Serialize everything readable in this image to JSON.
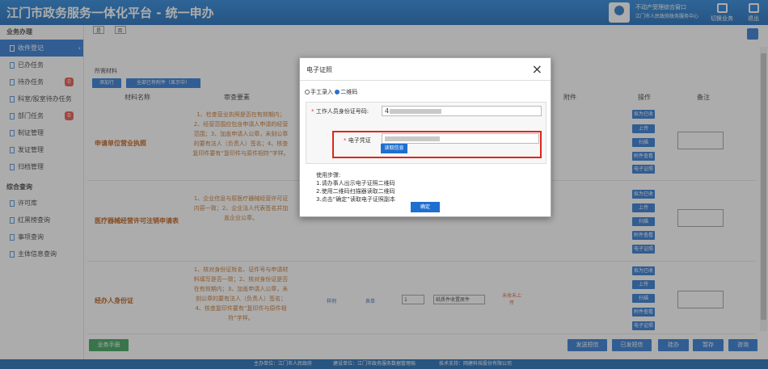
{
  "header": {
    "title": "江门市政务服务一体化平台 - 统一申办",
    "user_line1": "不动产受理综合窗口",
    "user_line2": "江门市人民政府政务服务中心",
    "switch_label": "切换业务",
    "logout_label": "退出"
  },
  "sidebar": {
    "section1": "业务办理",
    "items1": [
      {
        "label": "收件登记"
      },
      {
        "label": "已办任务"
      },
      {
        "label": "待办任务",
        "badge": "0"
      },
      {
        "label": "科室/股室待办任务"
      },
      {
        "label": "部门任务",
        "badge": "0"
      },
      {
        "label": "制证管理"
      },
      {
        "label": "发证管理"
      },
      {
        "label": "归档管理"
      }
    ],
    "section2": "综合查询",
    "items2": [
      {
        "label": "许可库"
      },
      {
        "label": "红黑榜查询"
      },
      {
        "label": "事项查询"
      },
      {
        "label": "主体信息查询"
      }
    ]
  },
  "main": {
    "tabs": [
      "是",
      "否"
    ],
    "section_title": "所需材料",
    "btn_add": "添加行",
    "btn_upload_all": "全部已有附件（显示中）",
    "columns": [
      "材料名称",
      "审查要素",
      "附件",
      "操作",
      "备注"
    ],
    "ops": [
      "拟为已收",
      "上传",
      "扫描",
      "附件查看",
      "电子证照"
    ],
    "rows": [
      {
        "name": "申请单位营业执照",
        "req": "1、检查营业执照是否在有效期内；2、经营范围应包含申请人申请的经营范围；3、加盖申请人公章，未刻公章的要有法人（负责人）签名；4、核查复印件要有“复印件与原件相符”字样。"
      },
      {
        "name": "医疗器械经营许可注销申请表",
        "req": "1、企业信息与原医疗器械经营许可证内容一致；2、企业法人代表签名并加盖企业公章。"
      },
      {
        "name": "经办人身份证",
        "req": "1、核对身份证姓名、证件号与申请材料填写是否一致；2、核对身份证是否在有效期内；3、加盖申请人公章，未刻公章的要有法人（负责人）签名；4、核查复印件要有“复印件与原件相符”字样。"
      }
    ],
    "row3_extra": {
      "link1": "样例",
      "link2": "表单",
      "num": "1",
      "select": "纸质件收置原件",
      "status": "未收未上传"
    },
    "bottom_left": "业务手册",
    "bottom_btns": [
      "发送短信",
      "已发短信",
      "挂办",
      "暂存",
      "咨询"
    ]
  },
  "modal": {
    "title": "电子证照",
    "close": "×",
    "radio_manual": "手工录入",
    "radio_qr": "二维码",
    "id_label": "工作人员身份证号码:",
    "id_value_prefix": "4",
    "cert_label": "电子凭证",
    "read_btn": "读取信息",
    "steps_title": "使用步骤:",
    "steps": [
      "1.请办事人出示电子证照二维码",
      "2.使用二维码扫描器读取二维码",
      "3.点击“确定”读取电子证照副本"
    ],
    "ok_btn": "确定"
  },
  "footer": {
    "host": "主办单位：江门市人民政府",
    "build": "建设单位：江门市政务服务数据管理局",
    "tech": "技术支持：网建科技股份有限公司"
  }
}
